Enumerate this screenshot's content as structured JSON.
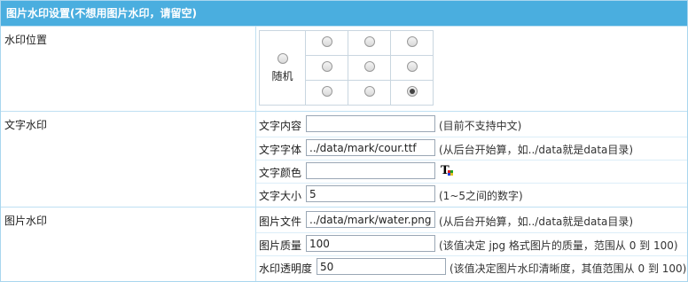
{
  "header": {
    "title": "图片水印设置(不想用图片水印，请留空)"
  },
  "position": {
    "label": "水印位置",
    "random_label": "随机",
    "cells": [
      [
        false,
        false,
        false
      ],
      [
        false,
        false,
        false
      ],
      [
        false,
        false,
        true
      ]
    ]
  },
  "text_watermark": {
    "label": "文字水印",
    "content_label": "文字内容",
    "content_value": "",
    "content_hint": "(目前不支持中文)",
    "font_label": "文字字体",
    "font_value": "../data/mark/cour.ttf",
    "font_hint": "(从后台开始算，如../data就是data目录)",
    "color_label": "文字颜色",
    "color_value": "",
    "color_icon": "text-color-picker-icon",
    "size_label": "文字大小",
    "size_value": "5",
    "size_hint": "(1~5之间的数字)"
  },
  "image_watermark": {
    "label": "图片水印",
    "file_label": "图片文件",
    "file_value": "../data/mark/water.png",
    "file_hint": "(从后台开始算，如../data就是data目录)",
    "quality_label": "图片质量",
    "quality_value": "100",
    "quality_hint": "(该值决定 jpg 格式图片的质量，范围从 0 到 100)",
    "opacity_label": "水印透明度",
    "opacity_value": "50",
    "opacity_hint": "(该值决定图片水印清晰度，其值范围从 0 到 100)"
  },
  "colors": {
    "header_bg": "#4aaedf",
    "border": "#bfe0f2"
  }
}
